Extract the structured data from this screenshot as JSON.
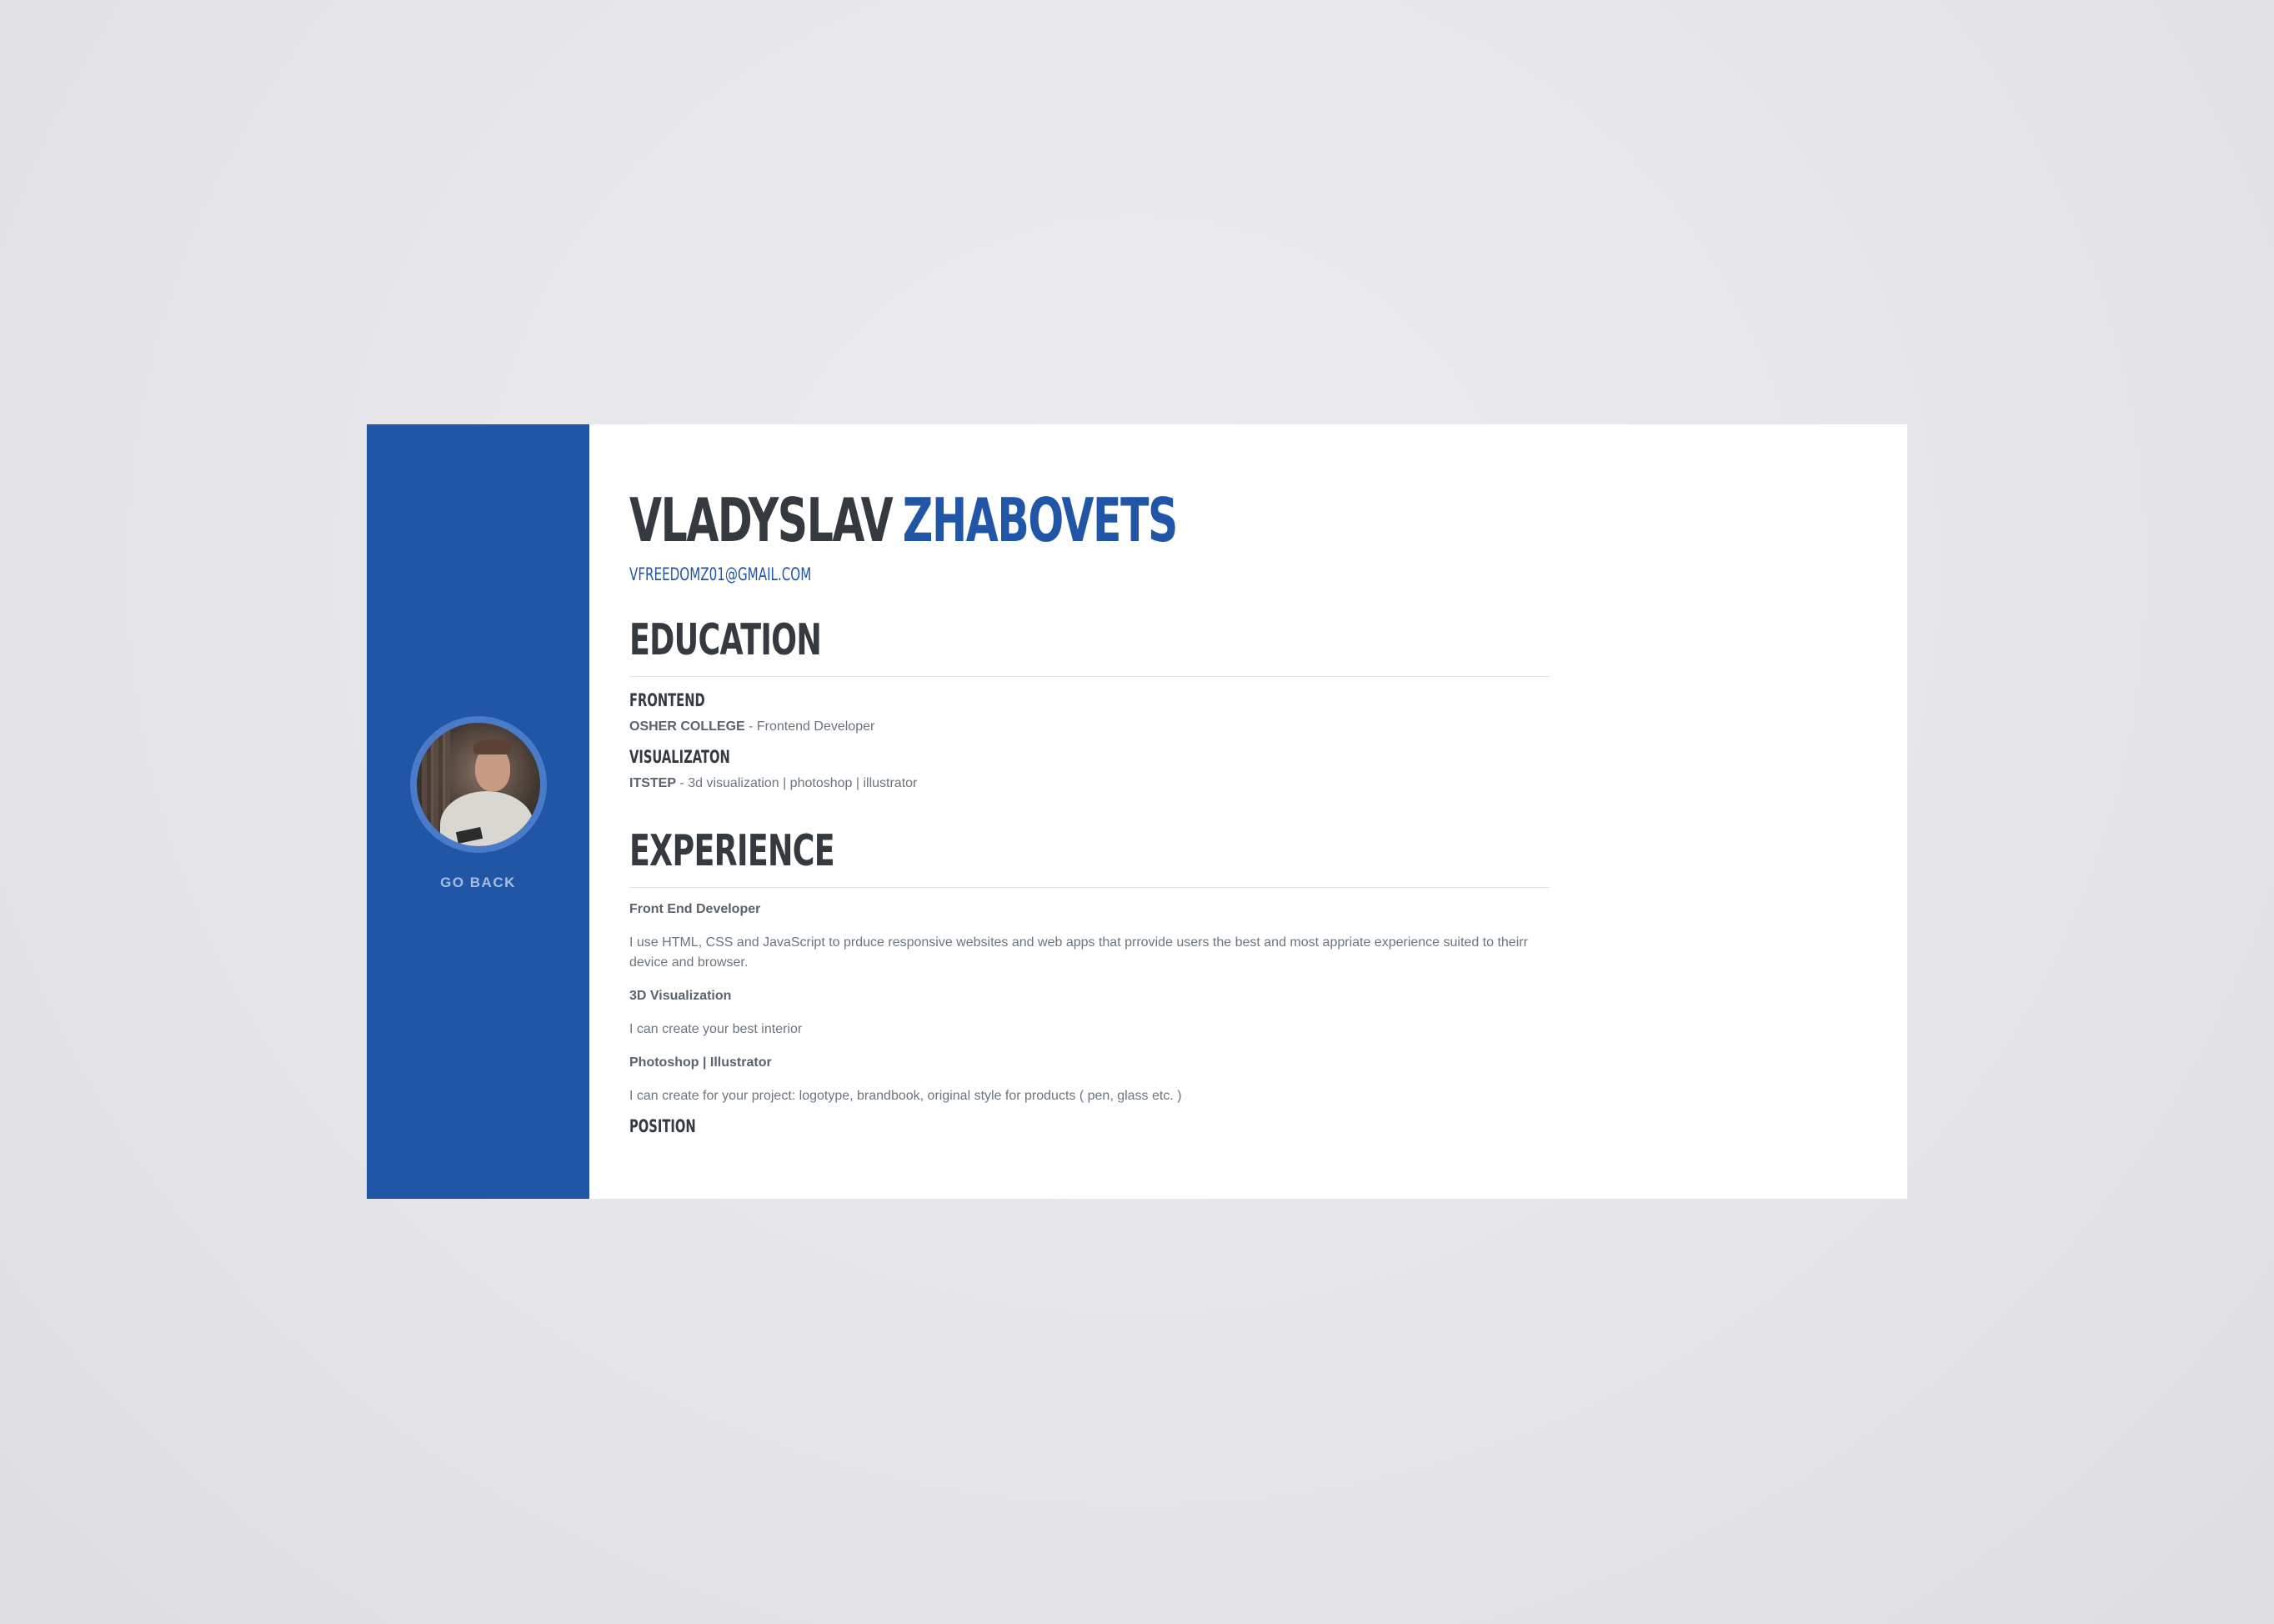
{
  "sidebar": {
    "go_back_label": "GO BACK",
    "accent_color": "#2156a7"
  },
  "header": {
    "first_name": "VLADYSLAV",
    "last_name": "ZHABOVETS",
    "email": "VFREEDOMZ01@GMAIL.COM"
  },
  "education": {
    "title": "EDUCATION",
    "items": [
      {
        "heading": "FRONTEND",
        "school": "OSHER COLLEGE",
        "detail": " - Frontend Developer"
      },
      {
        "heading": "VISUALIZATON",
        "school": "ITSTEP",
        "detail": " - 3d visualization | photoshop | illustrator"
      }
    ]
  },
  "experience": {
    "title": "EXPERIENCE",
    "items": [
      {
        "role": "Front End Developer",
        "description": "I use HTML, CSS and JavaScript to prduce responsive websites and web apps that prrovide users the best and most appriate experience suited to theirr device and browser."
      },
      {
        "role": "3D Visualization",
        "description": "I can create your best interior"
      },
      {
        "role": "Photoshop | Illustrator",
        "description": "I can create for your project: logotype, brandbook, original style for products ( pen, glass etc. )"
      }
    ],
    "next_heading": "POSITION"
  }
}
